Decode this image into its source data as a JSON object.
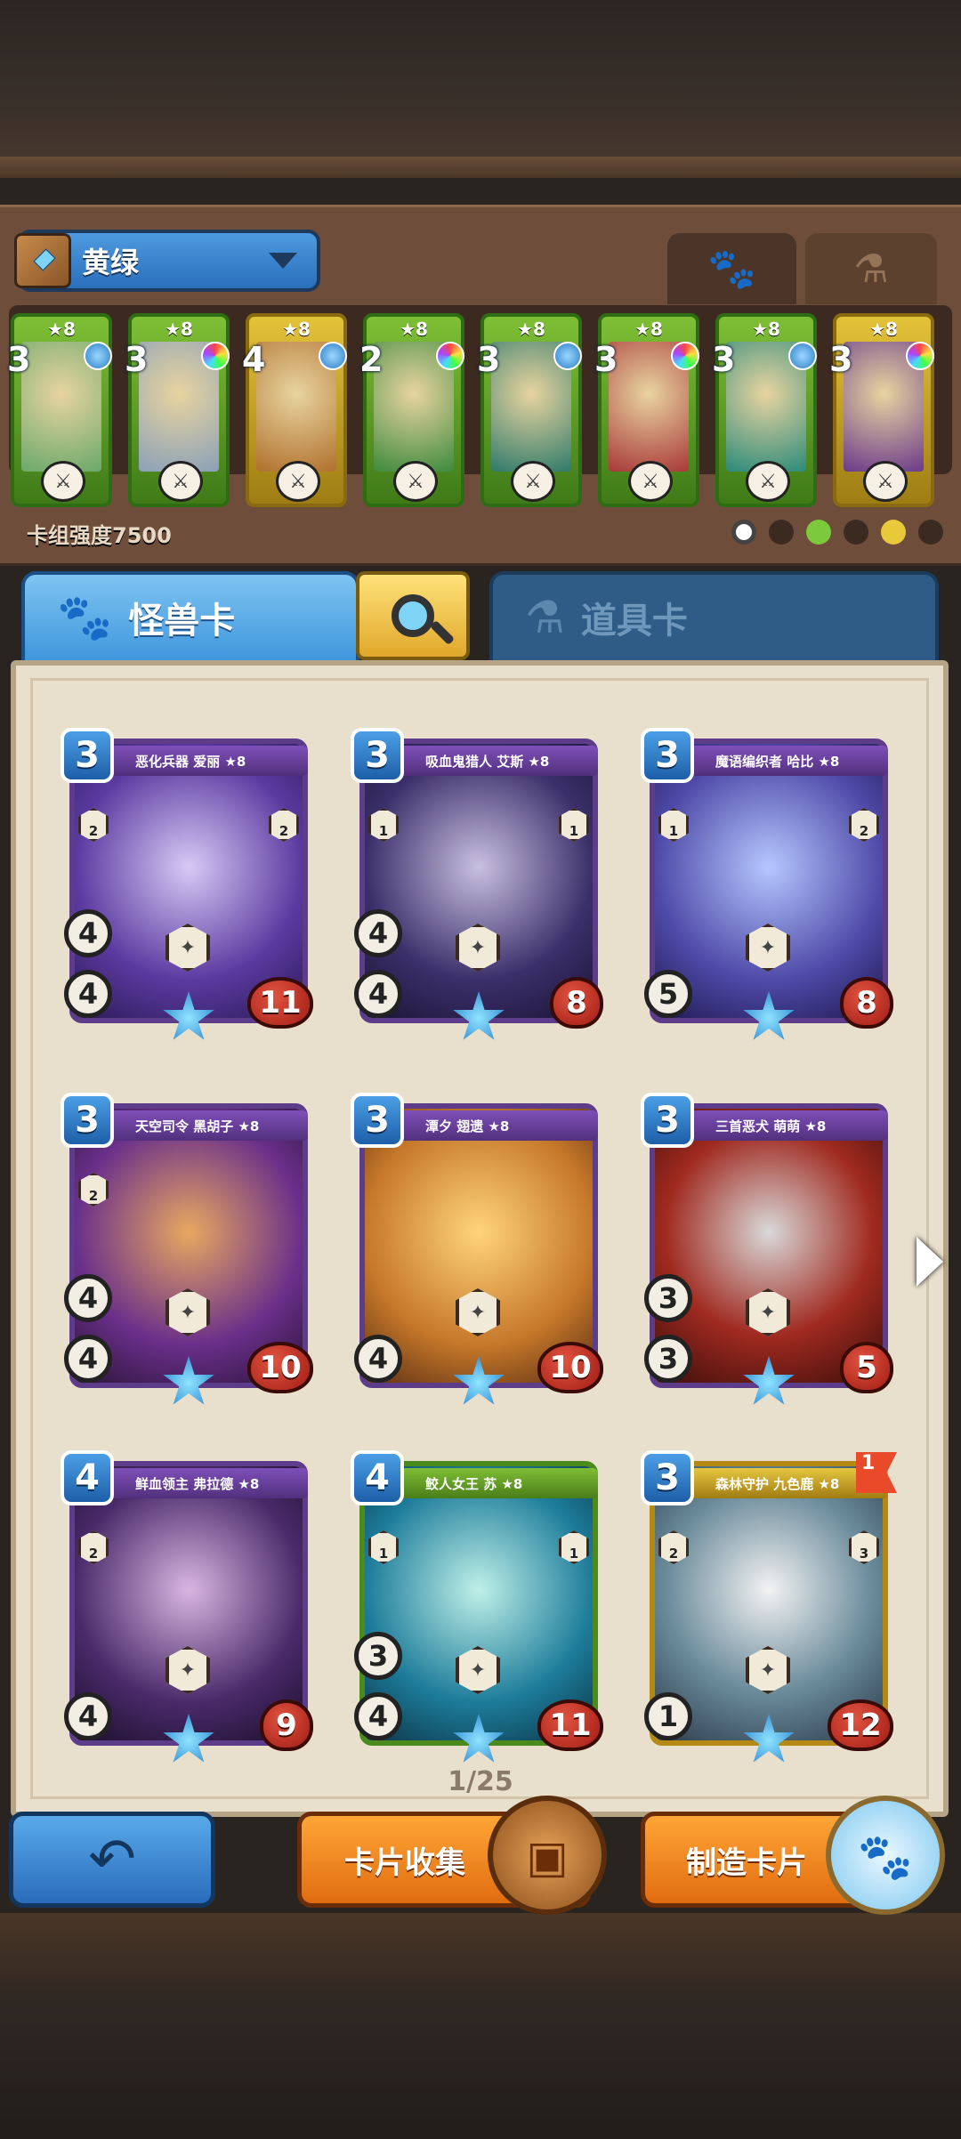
{
  "deck": {
    "name": "黄绿",
    "power": "卡组强度7500",
    "tabs": {
      "monster_icon": "paw-icon",
      "item_icon": "potion-icon"
    }
  },
  "deck_cards": [
    {
      "stars": "★8",
      "cost": "3",
      "color": "green"
    },
    {
      "stars": "★8",
      "cost": "3",
      "color": "green"
    },
    {
      "stars": "★8",
      "cost": "4",
      "color": "gold"
    },
    {
      "stars": "★8",
      "cost": "2",
      "color": "green"
    },
    {
      "stars": "★8",
      "cost": "3",
      "color": "green"
    },
    {
      "stars": "★8",
      "cost": "3",
      "color": "green"
    },
    {
      "stars": "★8",
      "cost": "3",
      "color": "green"
    },
    {
      "stars": "★8",
      "cost": "3",
      "color": "gold"
    }
  ],
  "tabs": {
    "monster": "怪兽卡",
    "item": "道具卡"
  },
  "cards": [
    {
      "name": "恶化兵器 爱丽 ★8",
      "cost": "3",
      "top": "4",
      "bottom": "4",
      "hp": "11",
      "badge_l": "2",
      "badge_r": "2",
      "frame": "purple"
    },
    {
      "name": "吸血鬼猎人 艾斯 ★8",
      "cost": "3",
      "top": "4",
      "bottom": "4",
      "hp": "8",
      "badge_l": "1",
      "badge_r": "1",
      "frame": "purple"
    },
    {
      "name": "魔语编织者 哈比 ★8",
      "cost": "3",
      "top": "",
      "bottom": "5",
      "hp": "8",
      "badge_l": "1",
      "badge_r": "2",
      "frame": "purple"
    },
    {
      "name": "天空司令 黑胡子 ★8",
      "cost": "3",
      "top": "4",
      "bottom": "4",
      "hp": "10",
      "badge_l": "2",
      "badge_r": "",
      "frame": "purple"
    },
    {
      "name": "潭夕 翅遗 ★8",
      "cost": "3",
      "top": "",
      "bottom": "4",
      "hp": "10",
      "badge_l": "",
      "badge_r": "",
      "frame": "purple"
    },
    {
      "name": "三首恶犬 萌萌 ★8",
      "cost": "3",
      "top": "3",
      "bottom": "3",
      "hp": "5",
      "badge_l": "",
      "badge_r": "",
      "frame": "purple"
    },
    {
      "name": "鲜血领主 弗拉德 ★8",
      "cost": "4",
      "top": "",
      "bottom": "4",
      "hp": "9",
      "badge_l": "2",
      "badge_r": "",
      "frame": "purple"
    },
    {
      "name": "鲛人女王 苏 ★8",
      "cost": "4",
      "top": "3",
      "bottom": "4",
      "hp": "11",
      "badge_l": "1",
      "badge_r": "1",
      "frame": "green"
    },
    {
      "name": "森林守护 九色鹿 ★8",
      "cost": "3",
      "top": "",
      "bottom": "1",
      "hp": "12",
      "badge_l": "2",
      "badge_r": "3",
      "frame": "gold",
      "flag": "1"
    }
  ],
  "pager": "1/25",
  "buttons": {
    "collect": "卡片收集",
    "craft": "制造卡片"
  }
}
